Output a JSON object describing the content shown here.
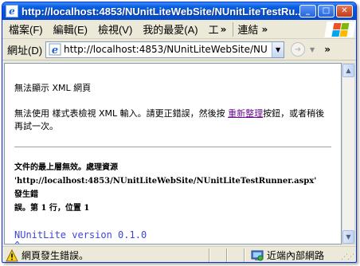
{
  "window": {
    "title": "http://localhost:4853/NUnitLiteWebSite/NUnitLiteTestRu...",
    "controls": {
      "minimize": "_",
      "maximize": "□",
      "close": "✕"
    }
  },
  "menubar": {
    "items": [
      "檔案(F)",
      "編輯(E)",
      "檢視(V)",
      "我的最愛(A)",
      "工"
    ],
    "chevron": "»",
    "links_label": "連結",
    "links_chevron": "»"
  },
  "address": {
    "label": "網址(D)",
    "url": "http://localhost:4853/NUnitLiteWebSite/NU",
    "go_chevron": "»"
  },
  "page": {
    "error_title": "無法顯示 XML 網頁",
    "error_msg_before": "無法使用 樣式表檢視 XML 輸入。請更正錯誤，然後按 ",
    "refresh_link": "重新整理",
    "error_msg_after": "按鈕，或者稍後再試一次。",
    "detail_line1": "文件的最上層無效。處理資源",
    "detail_line2": "'http://localhost:4853/NUnitLiteWebSite/NUnitLiteTestRunner.aspx' 發生錯",
    "detail_line3": "誤。第 1 行，位置 1",
    "source_line": "NUnitLite version 0.1.0",
    "caret": "^"
  },
  "status": {
    "text": "網頁發生錯誤。",
    "zone": "近端內部網路",
    "grip": "⋰⋰"
  },
  "colors": {
    "title_bar": "#0a5fe0",
    "chrome": "#ece9d8",
    "link_visited": "#6a0f8e",
    "source_text": "#3c46d9"
  },
  "icons": {
    "app": "ie-icon",
    "windows_logo": "windows-logo-icon",
    "status_warning": "warning-icon",
    "zone": "intranet-zone-icon"
  }
}
